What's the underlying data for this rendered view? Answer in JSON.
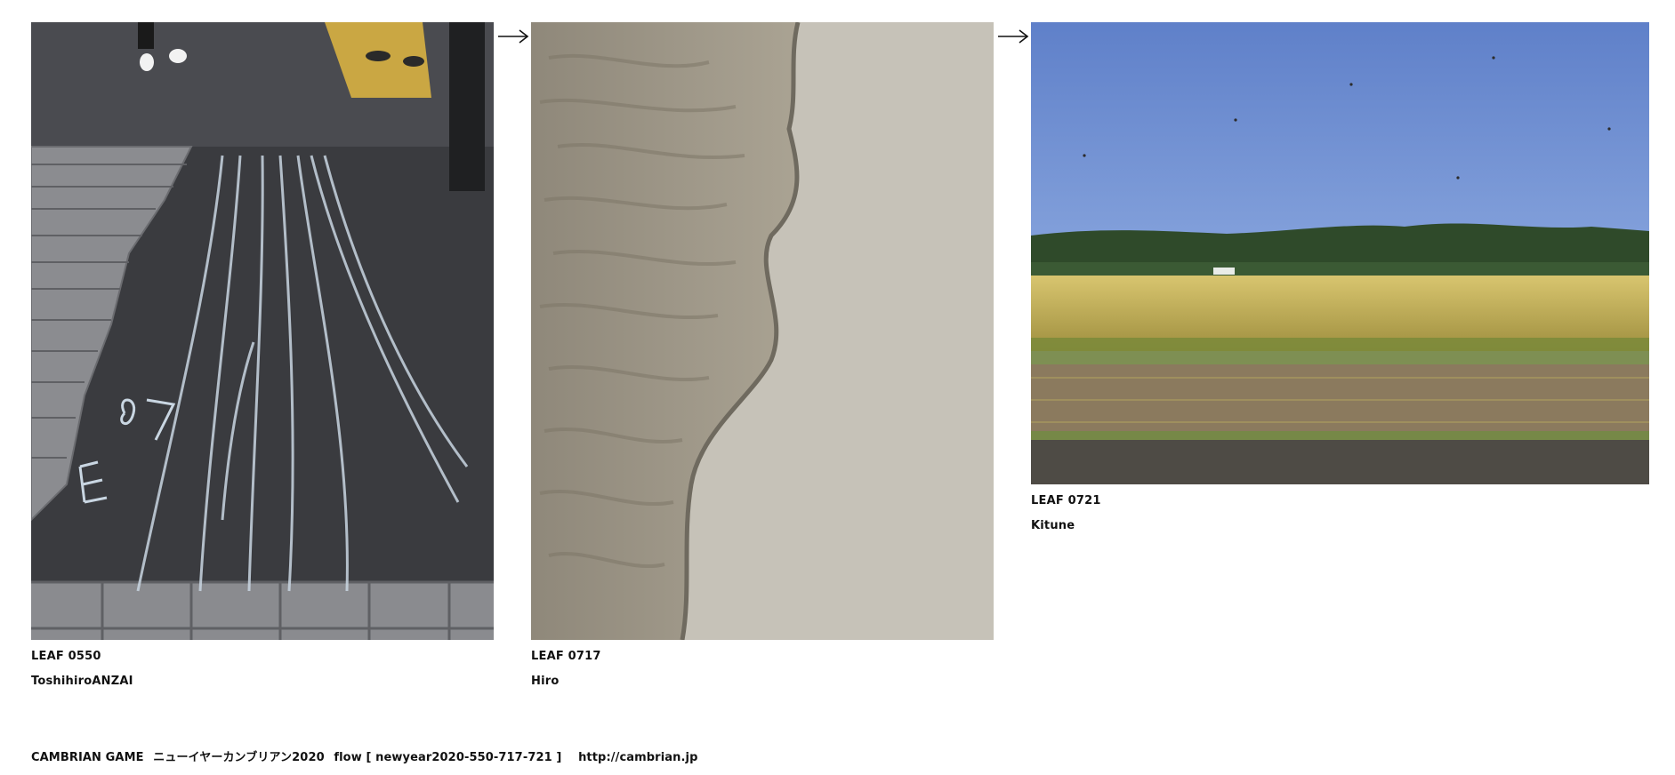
{
  "leaves": [
    {
      "id": "LEAF 0550",
      "author": "ToshihiroANZAI",
      "photo_icon": "chalk-street-photo"
    },
    {
      "id": "LEAF 0717",
      "author": "Hiro",
      "photo_icon": "sand-ripple-photo"
    },
    {
      "id": "LEAF 0721",
      "author": "Kitune",
      "photo_icon": "rice-field-photo"
    }
  ],
  "arrows": [
    "arrow-right-icon",
    "arrow-right-icon"
  ],
  "footer": {
    "game": "CAMBRIAN GAME",
    "title_jp": "ニューイヤーカンブリアン2020",
    "flow": "flow [ newyear2020-550-717-721 ]",
    "url": "http://cambrian.jp"
  },
  "colors": {
    "text": "#111111",
    "asphalt": "#3b3c40",
    "sand": "#b9b3a6",
    "sky": "#6f8fd6",
    "field": "#c9b04f"
  }
}
